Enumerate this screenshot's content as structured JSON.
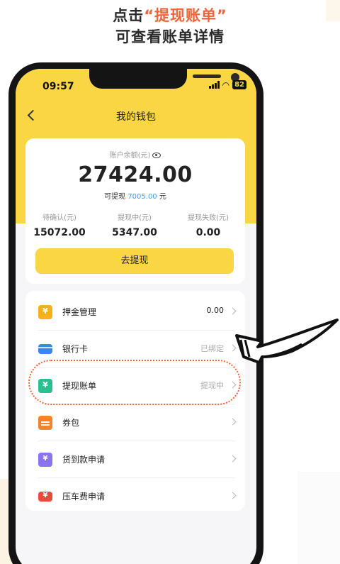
{
  "caption": {
    "line1_prefix": "点击",
    "line1_highlight": "“提现账单”",
    "line2": "可查看账单详情"
  },
  "status_bar": {
    "time": "09:57",
    "battery": "82"
  },
  "nav": {
    "back_icon": "chevron-left-icon",
    "title": "我的钱包"
  },
  "balance": {
    "label": "账户余额(元)",
    "eye_icon": "eye-icon",
    "amount": "27424.00",
    "withdrawable_prefix": "可提现",
    "withdrawable_amount": "7005.00",
    "withdrawable_suffix": "元",
    "stats": [
      {
        "label": "待确认(元)",
        "value": "15072.00"
      },
      {
        "label": "提现中(元)",
        "value": "5347.00"
      },
      {
        "label": "提现失败(元)",
        "value": "0.00"
      }
    ],
    "withdraw_button": "去提现"
  },
  "menu": {
    "items": [
      {
        "label": "押金管理",
        "value": "0.00",
        "icon": "shield-yuan-icon"
      },
      {
        "label": "银行卡",
        "value": "已绑定",
        "icon": "bank-card-icon"
      },
      {
        "label": "提现账单",
        "value": "提现中",
        "icon": "bill-icon"
      },
      {
        "label": "券包",
        "value": "",
        "icon": "coupon-icon"
      },
      {
        "label": "货到款申请",
        "value": "",
        "icon": "cod-icon"
      },
      {
        "label": "压车费申请",
        "value": "",
        "icon": "truck-icon"
      }
    ]
  },
  "colors": {
    "accent_yellow": "#fad645",
    "highlight_orange": "#f0633a",
    "link_blue": "#3aa0f0"
  }
}
